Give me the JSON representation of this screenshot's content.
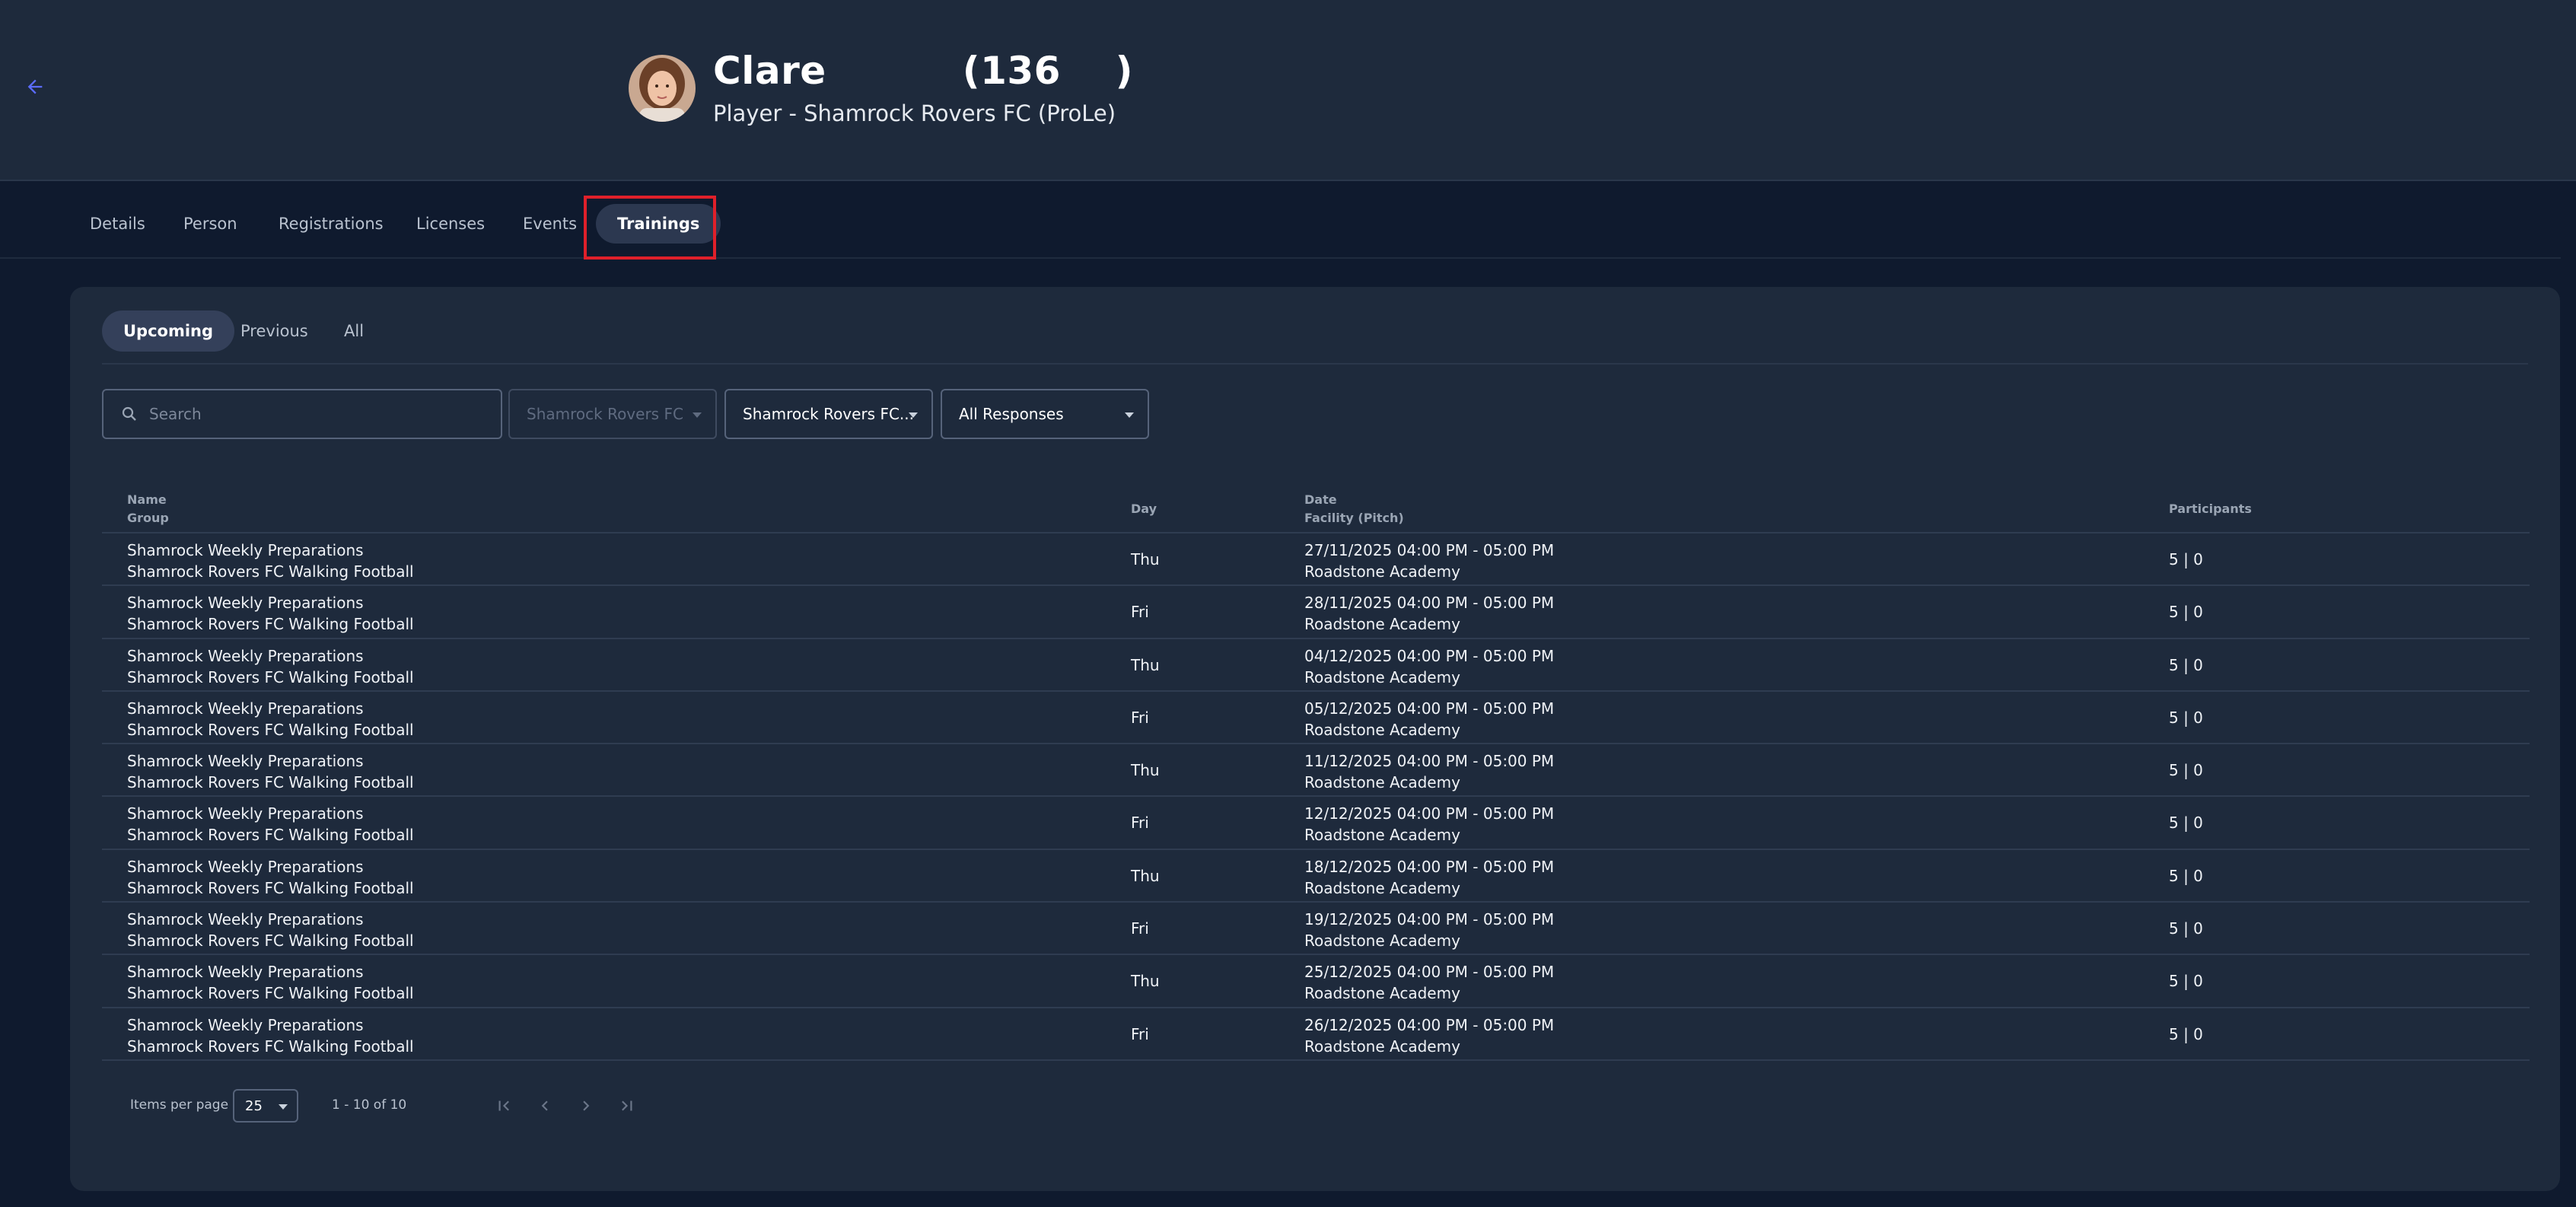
{
  "header": {
    "name": "Clare",
    "id_display": "(136    )",
    "subtitle": "Player - Shamrock Rovers FC (ProLe)"
  },
  "tabs": [
    {
      "label": "Details"
    },
    {
      "label": "Person"
    },
    {
      "label": "Registrations"
    },
    {
      "label": "Licenses"
    },
    {
      "label": "Events"
    },
    {
      "label": "Trainings",
      "active": true
    }
  ],
  "subtabs": [
    {
      "label": "Upcoming",
      "active": true
    },
    {
      "label": "Previous"
    },
    {
      "label": "All"
    }
  ],
  "filters": {
    "search_placeholder": "Search",
    "club": "Shamrock Rovers FC",
    "team": "Shamrock Rovers FC...",
    "responses": "All Responses"
  },
  "table": {
    "headers": {
      "name": "Name",
      "group": "Group",
      "day": "Day",
      "date": "Date",
      "facility": "Facility (Pitch)",
      "participants": "Participants"
    },
    "rows": [
      {
        "name": "Shamrock Weekly Preparations",
        "group": "Shamrock Rovers FC Walking Football",
        "day": "Thu",
        "date": "27/11/2025 04:00 PM - 05:00 PM",
        "facility": "Roadstone Academy",
        "participants": "5 | 0"
      },
      {
        "name": "Shamrock Weekly Preparations",
        "group": "Shamrock Rovers FC Walking Football",
        "day": "Fri",
        "date": "28/11/2025 04:00 PM - 05:00 PM",
        "facility": "Roadstone Academy",
        "participants": "5 | 0"
      },
      {
        "name": "Shamrock Weekly Preparations",
        "group": "Shamrock Rovers FC Walking Football",
        "day": "Thu",
        "date": "04/12/2025 04:00 PM - 05:00 PM",
        "facility": "Roadstone Academy",
        "participants": "5 | 0"
      },
      {
        "name": "Shamrock Weekly Preparations",
        "group": "Shamrock Rovers FC Walking Football",
        "day": "Fri",
        "date": "05/12/2025 04:00 PM - 05:00 PM",
        "facility": "Roadstone Academy",
        "participants": "5 | 0"
      },
      {
        "name": "Shamrock Weekly Preparations",
        "group": "Shamrock Rovers FC Walking Football",
        "day": "Thu",
        "date": "11/12/2025 04:00 PM - 05:00 PM",
        "facility": "Roadstone Academy",
        "participants": "5 | 0"
      },
      {
        "name": "Shamrock Weekly Preparations",
        "group": "Shamrock Rovers FC Walking Football",
        "day": "Fri",
        "date": "12/12/2025 04:00 PM - 05:00 PM",
        "facility": "Roadstone Academy",
        "participants": "5 | 0"
      },
      {
        "name": "Shamrock Weekly Preparations",
        "group": "Shamrock Rovers FC Walking Football",
        "day": "Thu",
        "date": "18/12/2025 04:00 PM - 05:00 PM",
        "facility": "Roadstone Academy",
        "participants": "5 | 0"
      },
      {
        "name": "Shamrock Weekly Preparations",
        "group": "Shamrock Rovers FC Walking Football",
        "day": "Fri",
        "date": "19/12/2025 04:00 PM - 05:00 PM",
        "facility": "Roadstone Academy",
        "participants": "5 | 0"
      },
      {
        "name": "Shamrock Weekly Preparations",
        "group": "Shamrock Rovers FC Walking Football",
        "day": "Thu",
        "date": "25/12/2025 04:00 PM - 05:00 PM",
        "facility": "Roadstone Academy",
        "participants": "5 | 0"
      },
      {
        "name": "Shamrock Weekly Preparations",
        "group": "Shamrock Rovers FC Walking Football",
        "day": "Fri",
        "date": "26/12/2025 04:00 PM - 05:00 PM",
        "facility": "Roadstone Academy",
        "participants": "5 | 0"
      }
    ]
  },
  "paginator": {
    "items_per_page_label": "Items per page",
    "page_size": "25",
    "range": "1 - 10 of 10"
  },
  "icons": {
    "back": "arrow-left-icon",
    "search": "search-icon",
    "first": "first-page-icon",
    "prev": "chevron-left-icon",
    "next": "chevron-right-icon",
    "last": "last-page-icon"
  },
  "colors": {
    "accent": "#5b6cff",
    "highlight": "#e0202a",
    "background": "#0f1a2e",
    "surface": "#1e2a3c"
  }
}
